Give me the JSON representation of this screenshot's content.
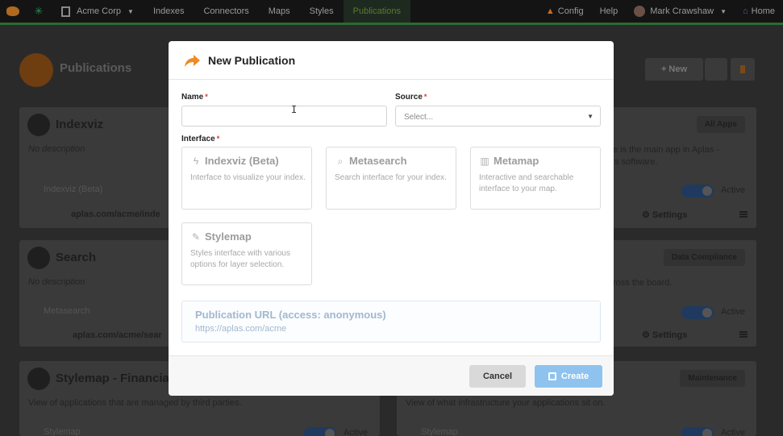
{
  "topbar": {
    "org": "Acme Corp",
    "nav": [
      "Indexes",
      "Connectors",
      "Maps",
      "Styles",
      "Publications"
    ],
    "active_nav": "Publications",
    "config": "Config",
    "help": "Help",
    "user": "Mark Crawshaw",
    "home": "Home"
  },
  "page": {
    "title": "Publications",
    "new_button": "New"
  },
  "cards": {
    "indexviz": {
      "title": "Indexviz",
      "desc": "No description",
      "interface": "Indexviz (Beta)",
      "url": "aplas.com/acme/inde"
    },
    "search": {
      "title": "Search",
      "desc": "No description",
      "interface": "Metasearch",
      "url": "aplas.com/acme/sear"
    },
    "stylemap": {
      "title": "Stylemap - Financia",
      "desc": "View of applications that are managed by third parties.",
      "interface": "Stylemap",
      "toggle": "Active"
    },
    "right1": {
      "badge": "All Apps",
      "desc_line1": "e is the main app in Aplas -",
      "desc_line2": "'s software.",
      "toggle": "Active",
      "settings": "Settings"
    },
    "right2": {
      "badge": "Data Compliance",
      "desc": "ross the board.",
      "toggle": "Active",
      "settings": "Settings"
    },
    "right3": {
      "badge": "Maintenance",
      "desc": "View of what infrastructure your applications sit on.",
      "interface": "Stylemap",
      "toggle": "Active"
    }
  },
  "modal": {
    "title": "New Publication",
    "name_label": "Name",
    "name_value": "",
    "source_label": "Source",
    "source_placeholder": "Select...",
    "interface_label": "Interface",
    "interfaces": [
      {
        "title": "Indexviz (Beta)",
        "desc": "Interface to visualize your index.",
        "icon": "bolt-icon"
      },
      {
        "title": "Metasearch",
        "desc": "Search interface for your index.",
        "icon": "search-icon"
      },
      {
        "title": "Metamap",
        "desc": "Interactive and searchable interface to your map.",
        "icon": "map-icon"
      },
      {
        "title": "Stylemap",
        "desc": "Styles interface with various options for layer selection.",
        "icon": "brush-icon"
      }
    ],
    "url_title": "Publication URL (access: anonymous)",
    "url_value": "https://aplas.com/acme",
    "cancel": "Cancel",
    "create": "Create"
  },
  "colors": {
    "accent_orange": "#f08a24",
    "primary_blue": "#8fc3ef",
    "required_red": "#e0342f",
    "nav_green": "#2d6a33"
  }
}
